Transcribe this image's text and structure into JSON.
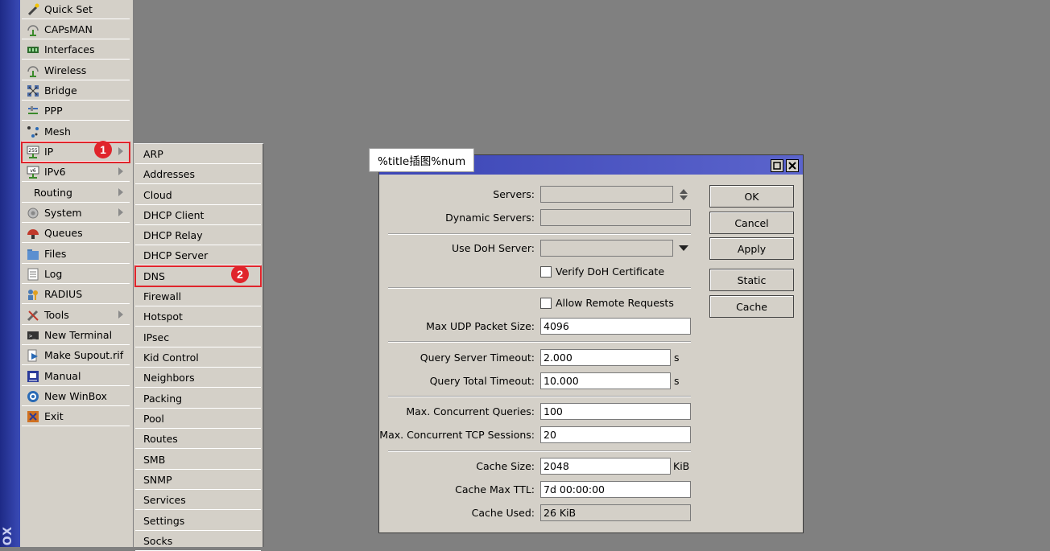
{
  "brand": "OX",
  "main_menu": {
    "items": [
      {
        "label": "Quick Set",
        "icon": "wand-icon",
        "submenu": false
      },
      {
        "label": "CAPsMAN",
        "icon": "antenna-icon",
        "submenu": false
      },
      {
        "label": "Interfaces",
        "icon": "interfaces-icon",
        "submenu": false
      },
      {
        "label": "Wireless",
        "icon": "wireless-icon",
        "submenu": false
      },
      {
        "label": "Bridge",
        "icon": "bridge-icon",
        "submenu": false
      },
      {
        "label": "PPP",
        "icon": "ppp-icon",
        "submenu": false
      },
      {
        "label": "Mesh",
        "icon": "mesh-icon",
        "submenu": false
      },
      {
        "label": "IP",
        "icon": "ip-icon",
        "submenu": true
      },
      {
        "label": "IPv6",
        "icon": "ipv6-icon",
        "submenu": true
      },
      {
        "label": "Routing",
        "icon": "",
        "submenu": true
      },
      {
        "label": "System",
        "icon": "system-icon",
        "submenu": true
      },
      {
        "label": "Queues",
        "icon": "queues-icon",
        "submenu": false
      },
      {
        "label": "Files",
        "icon": "folder-icon",
        "submenu": false
      },
      {
        "label": "Log",
        "icon": "log-icon",
        "submenu": false
      },
      {
        "label": "RADIUS",
        "icon": "radius-icon",
        "submenu": false
      },
      {
        "label": "Tools",
        "icon": "tools-icon",
        "submenu": true
      },
      {
        "label": "New Terminal",
        "icon": "terminal-icon",
        "submenu": false
      },
      {
        "label": "Make Supout.rif",
        "icon": "supout-icon",
        "submenu": false
      },
      {
        "label": "Manual",
        "icon": "manual-icon",
        "submenu": false
      },
      {
        "label": "New WinBox",
        "icon": "winbox-icon",
        "submenu": false
      },
      {
        "label": "Exit",
        "icon": "exit-icon",
        "submenu": false
      }
    ]
  },
  "ip_submenu": {
    "items": [
      "ARP",
      "Addresses",
      "Cloud",
      "DHCP Client",
      "DHCP Relay",
      "DHCP Server",
      "DNS",
      "Firewall",
      "Hotspot",
      "IPsec",
      "Kid Control",
      "Neighbors",
      "Packing",
      "Pool",
      "Routes",
      "SMB",
      "SNMP",
      "Services",
      "Settings",
      "Socks"
    ]
  },
  "annotations": {
    "step1": "1",
    "step2": "2"
  },
  "dialog": {
    "title_tag": "%title插图%num",
    "servers": {
      "label": "Servers:",
      "value": ""
    },
    "dynamic_servers": {
      "label": "Dynamic Servers:",
      "value": ""
    },
    "use_doh_server": {
      "label": "Use DoH Server:",
      "value": ""
    },
    "verify_doh": {
      "label": "Verify DoH Certificate",
      "checked": false
    },
    "allow_remote": {
      "label": "Allow Remote Requests",
      "checked": false
    },
    "max_udp": {
      "label": "Max UDP Packet Size:",
      "value": "4096"
    },
    "query_server_timeout": {
      "label": "Query Server Timeout:",
      "value": "2.000",
      "unit": "s"
    },
    "query_total_timeout": {
      "label": "Query Total Timeout:",
      "value": "10.000",
      "unit": "s"
    },
    "max_concurrent_queries": {
      "label": "Max. Concurrent Queries:",
      "value": "100"
    },
    "max_concurrent_tcp": {
      "label": "Max. Concurrent TCP Sessions:",
      "value": "20"
    },
    "cache_size": {
      "label": "Cache Size:",
      "value": "2048",
      "unit": "KiB"
    },
    "cache_max_ttl": {
      "label": "Cache Max TTL:",
      "value": "7d 00:00:00"
    },
    "cache_used": {
      "label": "Cache Used:",
      "value": "26 KiB"
    },
    "buttons": {
      "ok": "OK",
      "cancel": "Cancel",
      "apply": "Apply",
      "static": "Static",
      "cache": "Cache"
    }
  },
  "colors": {
    "highlight": "#e0242b",
    "titlebar": "#3b45b5",
    "panel": "#d4d0c8",
    "desktop": "#808080"
  }
}
